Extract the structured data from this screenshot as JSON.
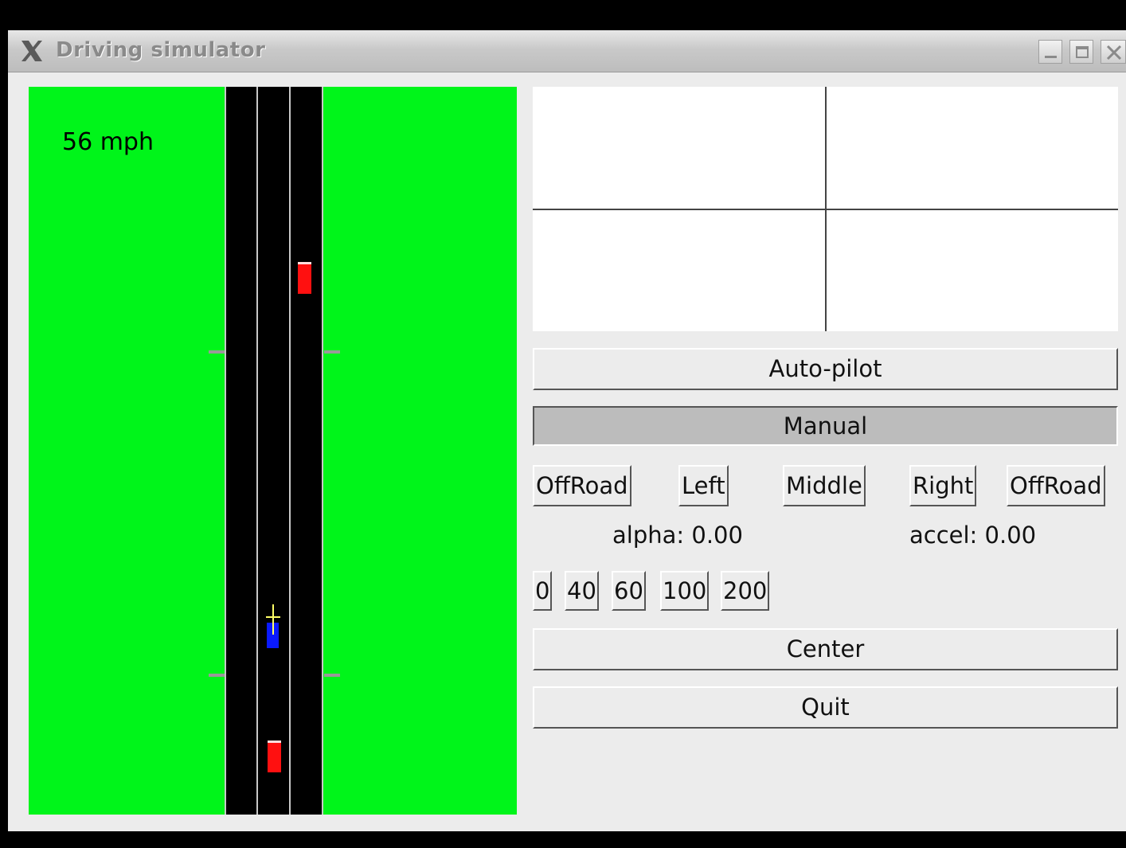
{
  "window": {
    "title": "Driving simulator"
  },
  "colors": {
    "grass": "#00f51a",
    "road": "#000000",
    "lane_line": "#c8c8c8",
    "player_car": "#0a1aff",
    "traffic_car": "#ff1010",
    "crosshair": "#ffff66",
    "panel_bg": "#ececec"
  },
  "road_view": {
    "speed_text": "56 mph"
  },
  "controls": {
    "autopilot_label": "Auto-pilot",
    "manual_label": "Manual",
    "lanes": [
      {
        "label": "OffRoad"
      },
      {
        "label": "Left"
      },
      {
        "label": "Middle"
      },
      {
        "label": "Right"
      },
      {
        "label": "OffRoad"
      }
    ],
    "alpha_text": "alpha: 0.00",
    "accel_text": "accel: 0.00",
    "speeds": [
      {
        "label": "0"
      },
      {
        "label": "40"
      },
      {
        "label": "60"
      },
      {
        "label": "100"
      },
      {
        "label": "200"
      }
    ],
    "center_label": "Center",
    "quit_label": "Quit"
  }
}
